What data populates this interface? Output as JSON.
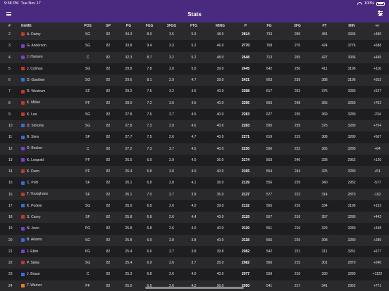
{
  "status_bar": {
    "time": "9:58 PM",
    "date": "Tue Nov 17",
    "battery": "100%"
  },
  "nav": {
    "title": "Stats"
  },
  "columns": [
    "#",
    "NAME",
    "POS",
    "GP",
    "PG",
    "FGG",
    "3FGG",
    "FTG",
    "MING",
    "P",
    "FG",
    "3FG",
    "FT",
    "MIN",
    "+/-"
  ],
  "colors": {
    "accent": "#4a2a7e",
    "logos": [
      "#c0392b",
      "#7b3fc6",
      "#3b6bd6",
      "#e67e22"
    ]
  },
  "rows": [
    {
      "rank": "2",
      "name": "A. Darby",
      "logo": "#c0392b",
      "pos": "SG",
      "gp": "82",
      "pg": "34.3",
      "fgg": "8.9",
      "tfgg": "3.5",
      "ftg": "5.9",
      "ming": "48.0",
      "p": "2814",
      "fg": "733",
      "tfg": "289",
      "ft": "481",
      "min": "3936",
      "pm": "+480"
    },
    {
      "rank": "3",
      "name": "G. Anderson",
      "logo": "#7b3fc6",
      "pos": "SG",
      "gp": "82",
      "pg": "33.8",
      "fgg": "9.4",
      "tfgg": "3.3",
      "ftg": "5.2",
      "ming": "46.0",
      "p": "2770",
      "fg": "768",
      "tfg": "270",
      "ft": "424",
      "min": "3776",
      "pm": "+688"
    },
    {
      "rank": "4",
      "name": "J. Hansen",
      "logo": "#7b3fc6",
      "pos": "C",
      "gp": "82",
      "pg": "32.3",
      "fgg": "8.7",
      "tfgg": "3.2",
      "ftg": "5.2",
      "ming": "48.0",
      "p": "2648",
      "fg": "713",
      "tfg": "265",
      "ft": "427",
      "min": "3936",
      "pm": "+445"
    },
    {
      "rank": "5",
      "name": "J. Colman",
      "logo": "#c0392b",
      "pos": "SG",
      "gp": "82",
      "pg": "29.8",
      "fgg": "7.8",
      "tfgg": "3.0",
      "ftg": "5.0",
      "ming": "39.0",
      "p": "2445",
      "fg": "642",
      "tfg": "250",
      "ft": "411",
      "min": "3196",
      "pm": "+116"
    },
    {
      "rank": "6",
      "name": "D. Gardiner",
      "logo": "#3b6bd6",
      "pos": "SG",
      "gp": "82",
      "pg": "29.6",
      "fgg": "8.1",
      "tfgg": "2.9",
      "ftg": "4.7",
      "ming": "39.0",
      "p": "2431",
      "fg": "663",
      "tfg": "239",
      "ft": "388",
      "min": "3196",
      "pm": "+553"
    },
    {
      "rank": "7",
      "name": "R. Westrum",
      "logo": "#c0392b",
      "pos": "SF",
      "gp": "82",
      "pg": "29.2",
      "fgg": "7.5",
      "tfgg": "3.2",
      "ftg": "4.6",
      "ming": "40.0",
      "p": "2398",
      "fg": "617",
      "tfg": "263",
      "ft": "375",
      "min": "3280",
      "pm": "+527"
    },
    {
      "rank": "8",
      "name": "K. Millen",
      "logo": "#c0392b",
      "pos": "PF",
      "gp": "82",
      "pg": "28.0",
      "fgg": "7.2",
      "tfgg": "3.0",
      "ftg": "4.5",
      "ming": "40.0",
      "p": "2295",
      "fg": "593",
      "tfg": "248",
      "ft": "365",
      "min": "3280",
      "pm": "+762"
    },
    {
      "rank": "9",
      "name": "K. Lee",
      "logo": "#c0392b",
      "pos": "SG",
      "gp": "82",
      "pg": "27.8",
      "fgg": "7.6",
      "tfgg": "2.7",
      "ftg": "4.5",
      "ming": "40.0",
      "p": "2283",
      "fg": "627",
      "tfg": "220",
      "ft": "369",
      "min": "3280",
      "pm": "-234"
    },
    {
      "rank": "10",
      "name": "D. Simonis",
      "logo": "#3b6bd6",
      "pos": "SG",
      "gp": "82",
      "pg": "27.8",
      "fgg": "7.3",
      "tfgg": "2.9",
      "ftg": "4.6",
      "ming": "40.0",
      "p": "2283",
      "fg": "595",
      "tfg": "239",
      "ft": "376",
      "min": "3280",
      "pm": "+754"
    },
    {
      "rank": "11",
      "name": "B. Sims",
      "logo": "#3b6bd6",
      "pos": "SF",
      "gp": "82",
      "pg": "27.7",
      "fgg": "7.5",
      "tfgg": "2.6",
      "ftg": "4.7",
      "ming": "40.0",
      "p": "2271",
      "fg": "619",
      "tfg": "215",
      "ft": "388",
      "min": "3280",
      "pm": "+567"
    },
    {
      "rank": "12",
      "name": "D. Booker",
      "logo": "#7b3fc6",
      "pos": "C",
      "gp": "82",
      "pg": "27.2",
      "fgg": "7.3",
      "tfgg": "2.7",
      "ftg": "4.5",
      "ming": "40.0",
      "p": "2230",
      "fg": "596",
      "tfg": "222",
      "ft": "365",
      "min": "3280",
      "pm": "+84"
    },
    {
      "rank": "13",
      "name": "K. Leopold",
      "logo": "#7b3fc6",
      "pos": "PF",
      "gp": "82",
      "pg": "26.5",
      "fgg": "6.9",
      "tfgg": "2.9",
      "ftg": "4.0",
      "ming": "36.0",
      "p": "2174",
      "fg": "563",
      "tfg": "240",
      "ft": "328",
      "min": "2952",
      "pm": "+120"
    },
    {
      "rank": "14",
      "name": "K. Dunn",
      "logo": "#c0392b",
      "pos": "PF",
      "gp": "82",
      "pg": "26.4",
      "fgg": "6.8",
      "tfgg": "3.0",
      "ftg": "4.0",
      "ming": "40.0",
      "p": "2165",
      "fg": "554",
      "tfg": "244",
      "ft": "325",
      "min": "3280",
      "pm": "+51"
    },
    {
      "rank": "15",
      "name": "C. Pohl",
      "logo": "#3b6bd6",
      "pos": "SF",
      "gp": "82",
      "pg": "26.1",
      "fgg": "6.8",
      "tfgg": "2.8",
      "ftg": "4.1",
      "ming": "36.0",
      "p": "2139",
      "fg": "556",
      "tfg": "229",
      "ft": "340",
      "min": "2952",
      "pm": "-577"
    },
    {
      "rank": "16",
      "name": "T. Younghans",
      "logo": "#c0392b",
      "pos": "SF",
      "gp": "82",
      "pg": "26.1",
      "fgg": "7.0",
      "tfgg": "2.7",
      "ftg": "3.8",
      "ming": "35.0",
      "p": "2137",
      "fg": "577",
      "tfg": "223",
      "ft": "314",
      "min": "2870",
      "pm": "-162"
    },
    {
      "rank": "17",
      "name": "K. Podein",
      "logo": "#3b6bd6",
      "pos": "SG",
      "gp": "82",
      "pg": "26.0",
      "fgg": "6.9",
      "tfgg": "2.6",
      "ftg": "4.0",
      "ming": "39.0",
      "p": "2132",
      "fg": "565",
      "tfg": "216",
      "ft": "334",
      "min": "3196",
      "pm": "+152"
    },
    {
      "rank": "18",
      "name": "S. Carey",
      "logo": "#c0392b",
      "pos": "SF",
      "gp": "82",
      "pg": "25.8",
      "fgg": "6.8",
      "tfgg": "2.6",
      "ftg": "4.4",
      "ming": "40.0",
      "p": "2119",
      "fg": "557",
      "tfg": "216",
      "ft": "357",
      "min": "3280",
      "pm": "+442"
    },
    {
      "rank": "19",
      "name": "N. Jovic",
      "logo": "#7b3fc6",
      "pos": "PG",
      "gp": "82",
      "pg": "25.8",
      "fgg": "6.8",
      "tfgg": "2.6",
      "ftg": "4.0",
      "ming": "40.0",
      "p": "2119",
      "fg": "561",
      "tfg": "216",
      "ft": "329",
      "min": "3280",
      "pm": "+348"
    },
    {
      "rank": "20",
      "name": "B. Adams",
      "logo": "#3b6bd6",
      "pos": "SG",
      "gp": "82",
      "pg": "25.8",
      "fgg": "6.9",
      "tfgg": "2.8",
      "ftg": "3.8",
      "ming": "40.0",
      "p": "2118",
      "fg": "566",
      "tfg": "226",
      "ft": "308",
      "min": "3280",
      "pm": "+289"
    },
    {
      "rank": "21",
      "name": "J. Eblin",
      "logo": "#7b3fc6",
      "pos": "PG",
      "gp": "82",
      "pg": "25.4",
      "fgg": "6.6",
      "tfgg": "2.7",
      "ftg": "3.8",
      "ming": "39.8",
      "p": "2082",
      "fg": "542",
      "tfg": "221",
      "ft": "311",
      "min": "3261",
      "pm": "+677"
    },
    {
      "rank": "22",
      "name": "P. Siska",
      "logo": "#c0392b",
      "pos": "SG",
      "gp": "82",
      "pg": "25.4",
      "fgg": "6.9",
      "tfgg": "2.6",
      "ftg": "3.7",
      "ming": "35.0",
      "p": "2082",
      "fg": "566",
      "tfg": "215",
      "ft": "301",
      "min": "2870",
      "pm": "+240"
    },
    {
      "rank": "23",
      "name": "J. Braun",
      "logo": "#3b6bd6",
      "pos": "C",
      "gp": "82",
      "pg": "25.3",
      "fgg": "6.8",
      "tfgg": "2.6",
      "ftg": "4.0",
      "ming": "40.0",
      "p": "2077",
      "fg": "559",
      "tfg": "216",
      "ft": "330",
      "min": "3280",
      "pm": "+1122"
    },
    {
      "rank": "24",
      "name": "T. Warner",
      "logo": "#e67e22",
      "pos": "PF",
      "gp": "82",
      "pg": "25.0",
      "fgg": "6.6",
      "tfgg": "2.6",
      "ftg": "4.2",
      "ming": "36.0",
      "p": "2050",
      "fg": "541",
      "tfg": "217",
      "ft": "341",
      "min": "2952",
      "pm": "+771"
    }
  ]
}
